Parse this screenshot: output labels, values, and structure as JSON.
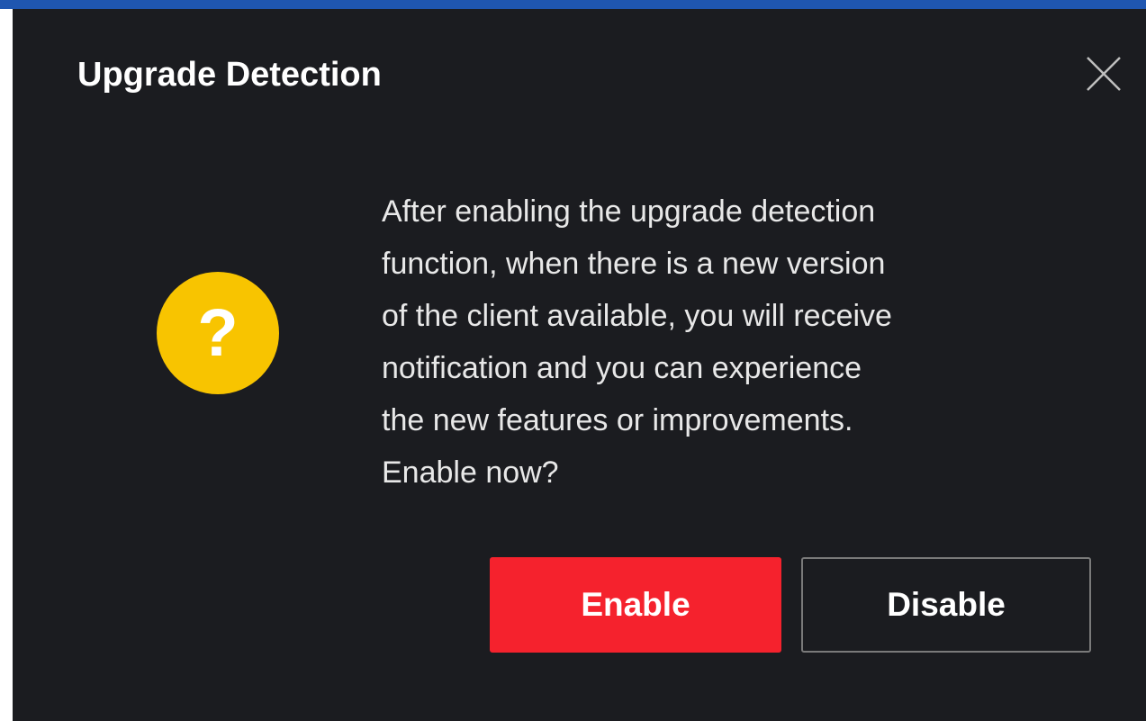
{
  "dialog": {
    "title": "Upgrade Detection",
    "message": "After enabling the upgrade detection\nfunction, when there is a new version\nof the client available, you will receive\nnotification and you can experience\nthe new features or improvements.\nEnable now?",
    "icon": {
      "name": "question-icon",
      "glyph": "?",
      "color": "#f8c400"
    },
    "close_icon": "close-icon",
    "buttons": {
      "enable_label": "Enable",
      "disable_label": "Disable"
    }
  },
  "colors": {
    "background": "#1b1c20",
    "accent_strip": "#1f56b0",
    "primary_button": "#f5222d",
    "secondary_border": "#7a7a7a",
    "text": "#ffffff"
  }
}
